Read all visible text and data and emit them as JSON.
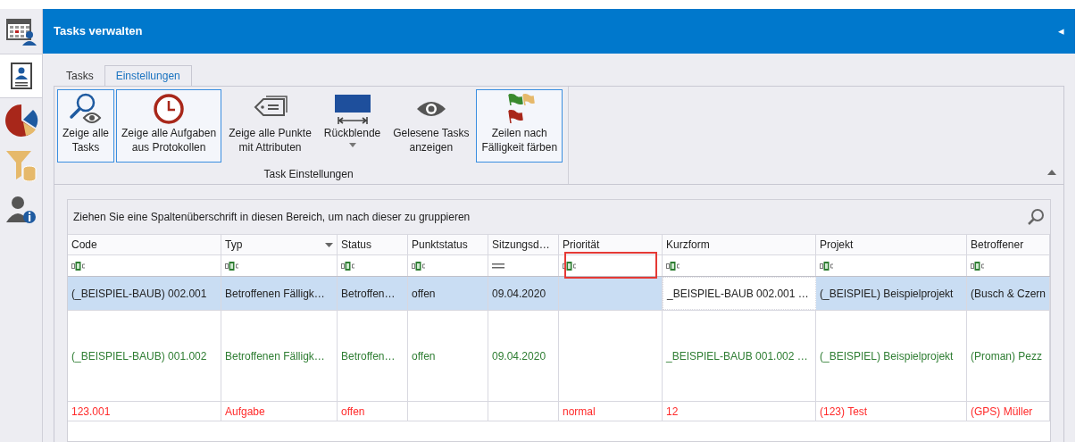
{
  "sidebar": {
    "items": [
      {
        "selected": false
      },
      {
        "selected": true
      },
      {
        "selected": false
      },
      {
        "selected": false
      },
      {
        "selected": false
      }
    ]
  },
  "header": {
    "title": "Tasks verwalten",
    "collapse_glyph": "◂"
  },
  "tabs": [
    {
      "label": "Tasks",
      "selected": false
    },
    {
      "label": "Einstellungen",
      "selected": true
    }
  ],
  "ribbon": {
    "group_label": "Task Einstellungen",
    "buttons": [
      {
        "lines": [
          "Zeige alle",
          "Tasks"
        ],
        "selected": true,
        "dropdown": false
      },
      {
        "lines": [
          "Zeige alle Aufgaben",
          "aus Protokollen"
        ],
        "selected": true,
        "dropdown": false
      },
      {
        "lines": [
          "Zeige alle Punkte",
          "mit Attributen"
        ],
        "selected": false,
        "dropdown": false
      },
      {
        "lines": [
          "Rückblende"
        ],
        "selected": false,
        "dropdown": true
      },
      {
        "lines": [
          "Gelesene Tasks",
          "anzeigen"
        ],
        "selected": false,
        "dropdown": false
      },
      {
        "lines": [
          "Zeilen nach",
          "Fälligkeit färben"
        ],
        "selected": true,
        "dropdown": false
      }
    ]
  },
  "grid": {
    "group_hint": "Ziehen Sie eine Spaltenüberschrift in diesen Bereich, um nach dieser zu gruppieren",
    "columns": [
      {
        "label": "Code",
        "kind": "text",
        "sort_arrow": false,
        "highlighted": false
      },
      {
        "label": "Typ",
        "kind": "text",
        "sort_arrow": true,
        "highlighted": false
      },
      {
        "label": "Status",
        "kind": "text",
        "sort_arrow": false,
        "highlighted": false
      },
      {
        "label": "Punktstatus",
        "kind": "text",
        "sort_arrow": false,
        "highlighted": false
      },
      {
        "label": "Sitzungsd…",
        "kind": "date",
        "sort_arrow": false,
        "highlighted": false
      },
      {
        "label": "Priorität",
        "kind": "text",
        "sort_arrow": false,
        "highlighted": true
      },
      {
        "label": "Kurzform",
        "kind": "text",
        "sort_arrow": false,
        "highlighted": false
      },
      {
        "label": "Projekt",
        "kind": "text",
        "sort_arrow": false,
        "highlighted": false
      },
      {
        "label": "Betroffener",
        "kind": "text",
        "sort_arrow": false,
        "highlighted": false
      }
    ],
    "rows": [
      {
        "selected": true,
        "color": "#222222",
        "cells": [
          {
            "text": "(_BEISPIEL-BAUB) 002.001",
            "focused": false
          },
          {
            "text": "Betroffenen Fälligk…",
            "focused": false
          },
          {
            "text": "Betroffen…",
            "focused": false
          },
          {
            "text": "offen",
            "focused": false
          },
          {
            "text": "09.04.2020",
            "focused": false
          },
          {
            "text": "",
            "focused": false
          },
          {
            "text": "_BEISPIEL-BAUB 002.001 …",
            "focused": true
          },
          {
            "text": "(_BEISPIEL) Beispielprojekt",
            "focused": false
          },
          {
            "text": "(Busch & Czern",
            "focused": false
          }
        ]
      },
      {
        "selected": false,
        "color": "#2e7d32",
        "cells": [
          {
            "text": "(_BEISPIEL-BAUB) 001.002",
            "focused": false
          },
          {
            "text": "Betroffenen Fälligk…",
            "focused": false
          },
          {
            "text": "Betroffen…",
            "focused": false
          },
          {
            "text": "offen",
            "focused": false
          },
          {
            "text": "09.04.2020",
            "focused": false
          },
          {
            "text": "",
            "focused": false
          },
          {
            "text": "_BEISPIEL-BAUB 001.002 …",
            "focused": false
          },
          {
            "text": "(_BEISPIEL) Beispielprojekt",
            "focused": false
          },
          {
            "text": "(Proman) Pezz",
            "focused": false
          }
        ]
      },
      {
        "selected": false,
        "color": "#ff2a2a",
        "cells": [
          {
            "text": "123.001",
            "focused": false
          },
          {
            "text": "Aufgabe",
            "focused": false
          },
          {
            "text": "offen",
            "focused": false
          },
          {
            "text": "",
            "focused": false
          },
          {
            "text": "",
            "focused": false
          },
          {
            "text": "normal",
            "focused": false
          },
          {
            "text": "12",
            "focused": false
          },
          {
            "text": "(123) Test",
            "focused": false
          },
          {
            "text": "(GPS) Müller",
            "focused": false
          }
        ]
      }
    ]
  }
}
